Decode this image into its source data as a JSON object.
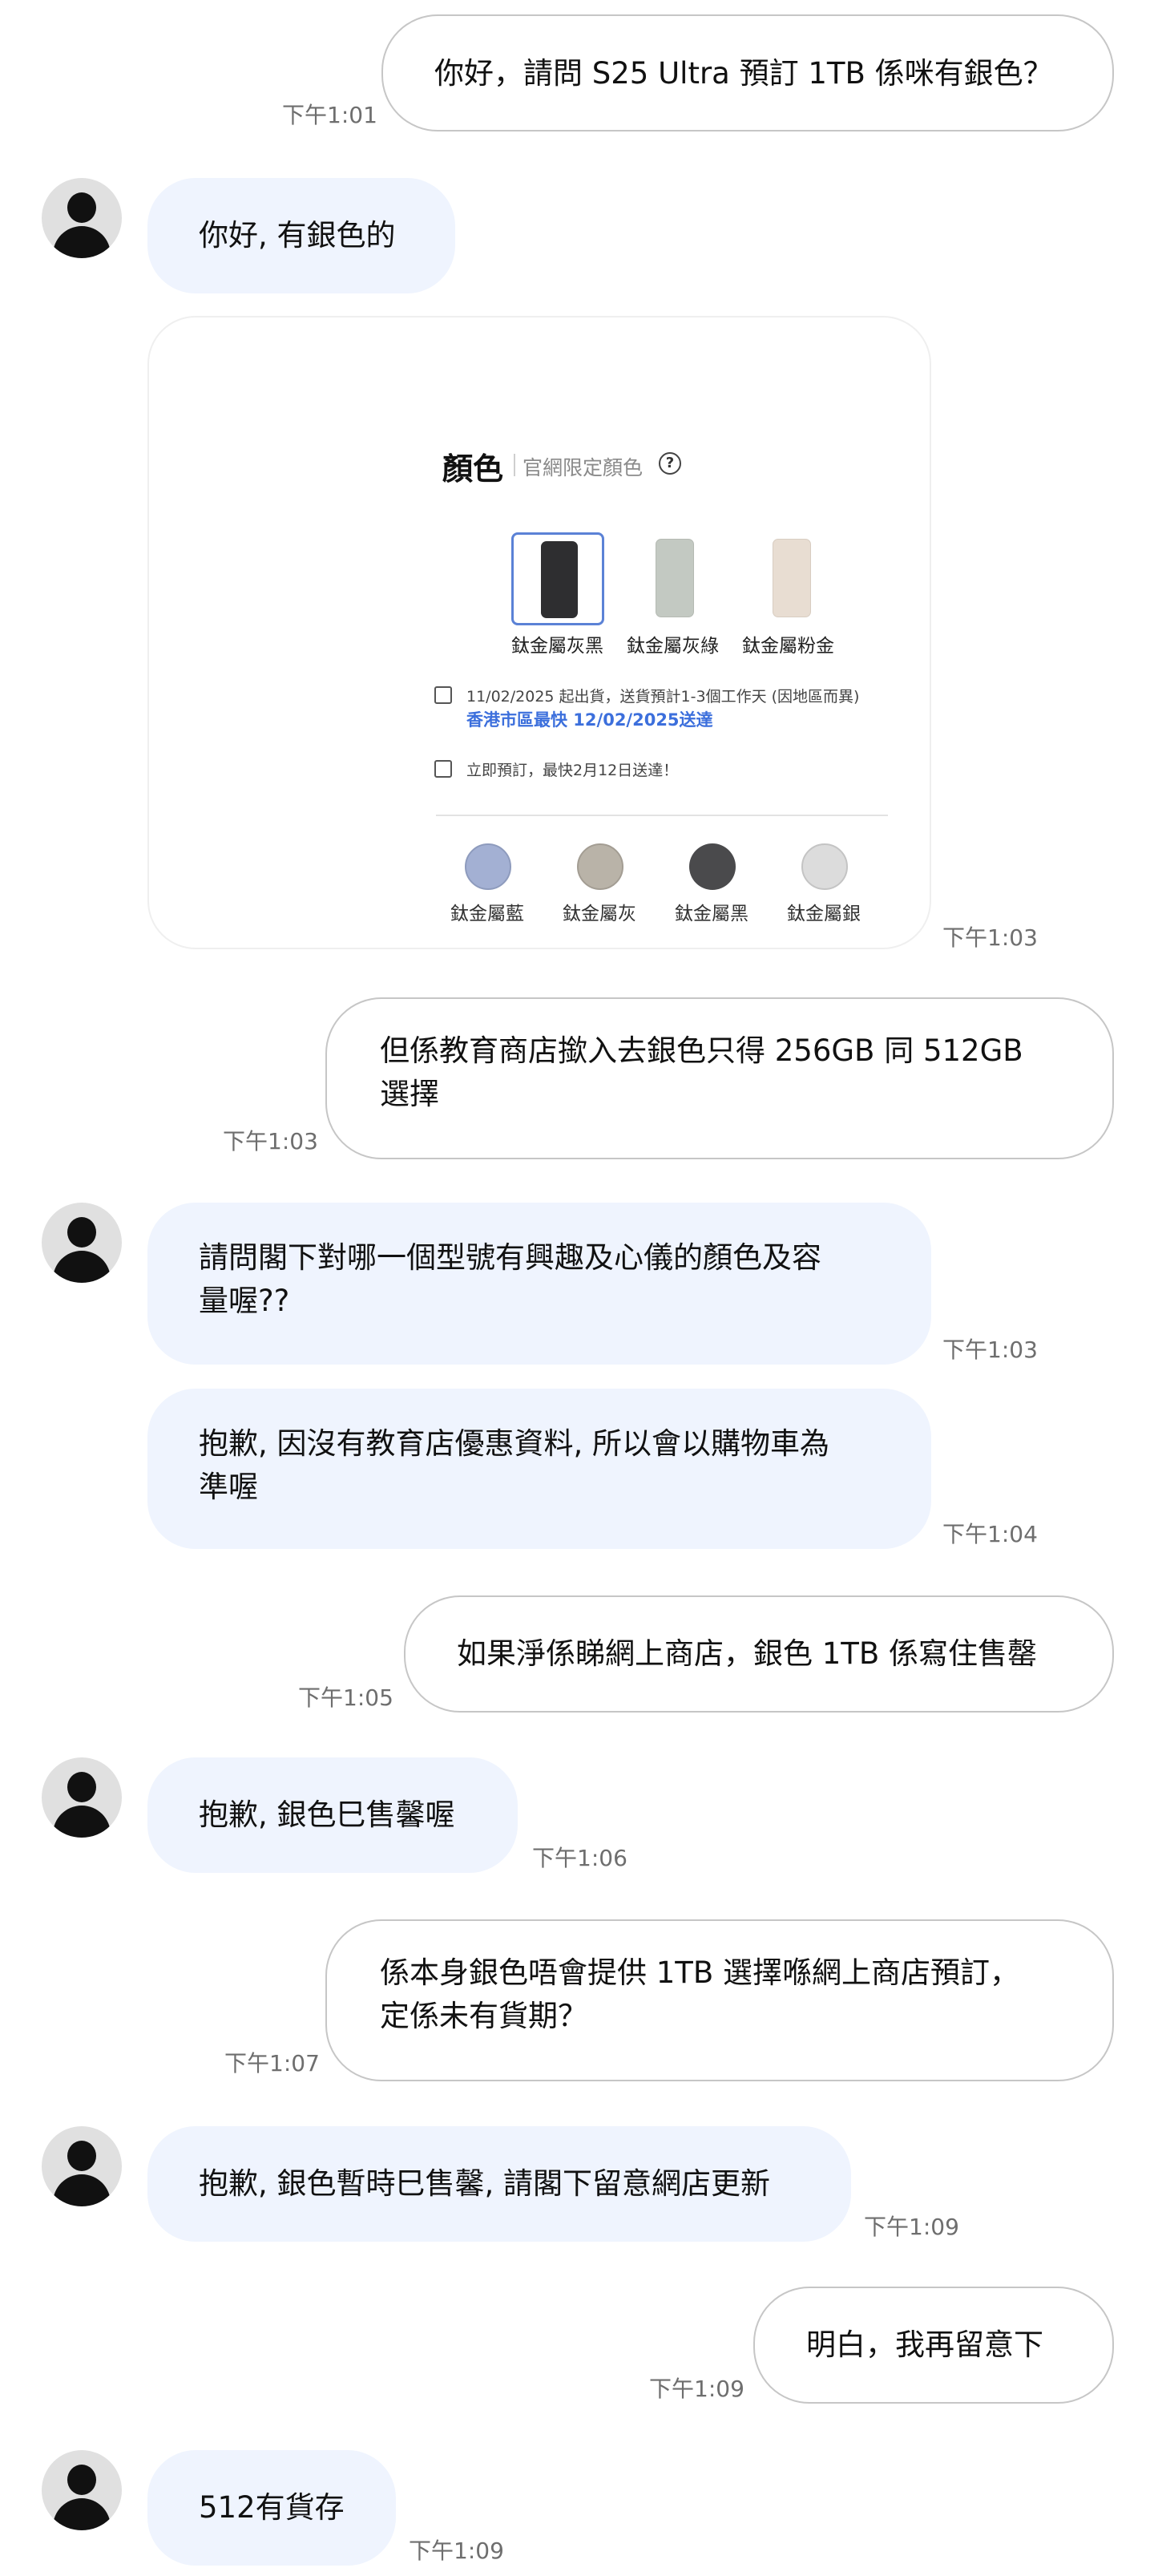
{
  "messages": [
    {
      "text": "你好，請問 S25 Ultra 預訂 1TB 係咪有銀色？",
      "time": "下午1:01"
    },
    {
      "text": "你好, 有銀色的"
    },
    {
      "time": "下午1:03"
    },
    {
      "text": "但係教育商店撳入去銀色只得 256GB 同 512GB 選擇",
      "time": "下午1:03"
    },
    {
      "text": "請問閣下對哪一個型號有興趣及心儀的顏色及容量喔??",
      "time": "下午1:03"
    },
    {
      "text": "抱歉, 因沒有教育店優惠資料, 所以會以購物車為準喔",
      "time": "下午1:04"
    },
    {
      "text": "如果淨係睇網上商店，銀色 1TB 係寫住售罄",
      "time": "下午1:05"
    },
    {
      "text": "抱歉, 銀色巳售馨喔",
      "time": "下午1:06"
    },
    {
      "text": "係本身銀色唔會提供 1TB 選擇喺網上商店預訂，定係未有貨期？",
      "time": "下午1:07"
    },
    {
      "text": "抱歉, 銀色暫時巳售馨, 請閣下留意網店更新",
      "time": "下午1:09"
    },
    {
      "text": "明白，我再留意下",
      "time": "下午1:09"
    },
    {
      "text": "512有貨存",
      "time": "下午1:09"
    }
  ],
  "lines": {
    "m3a": "但係教育商店撳入去銀色只得 256GB 同 512GB",
    "m3b": "選擇",
    "m4a": "請問閣下對哪一個型號有興趣及心儀的顏色及容",
    "m4b": "量喔??",
    "m5a": "抱歉, 因沒有教育店優惠資料, 所以會以購物車為",
    "m5b": "準喔",
    "m8a": "係本身銀色唔會提供 1TB 選擇喺網上商店預訂，",
    "m8b": "定係未有貨期？"
  },
  "card": {
    "title": "顏色",
    "subtitle": "官網限定顏色",
    "help_icon": "?",
    "phones": [
      {
        "label": "鈦金屬灰黑",
        "color": "#2e2e30",
        "selected": true
      },
      {
        "label": "鈦金屬灰綠",
        "color": "#c3c9c2",
        "selected": false
      },
      {
        "label": "鈦金屬粉金",
        "color": "#e8ddd2",
        "selected": false
      }
    ],
    "ship_line1": "11/02/2025 起出貨，送貨預計1-3個工作天 (因地區而異)",
    "ship_link": "香港市區最快 12/02/2025送達",
    "ship_line2": "立即預訂，最快2月12日送達！",
    "swatches": [
      {
        "label": "鈦金屬藍",
        "color": "#a3b0d3"
      },
      {
        "label": "鈦金屬灰",
        "color": "#b9b3a8"
      },
      {
        "label": "鈦金屬黑",
        "color": "#4a4a4c"
      },
      {
        "label": "鈦金屬銀",
        "color": "#dcdcdc"
      }
    ]
  },
  "colors": {
    "incoming_bubble": "#eff4fe",
    "outgoing_border": "#c6c6c6",
    "link_blue": "#3c6fdc"
  },
  "icons": {
    "avatar": "person-avatar-icon",
    "help": "question-circle-icon",
    "shipping": "package-icon"
  }
}
